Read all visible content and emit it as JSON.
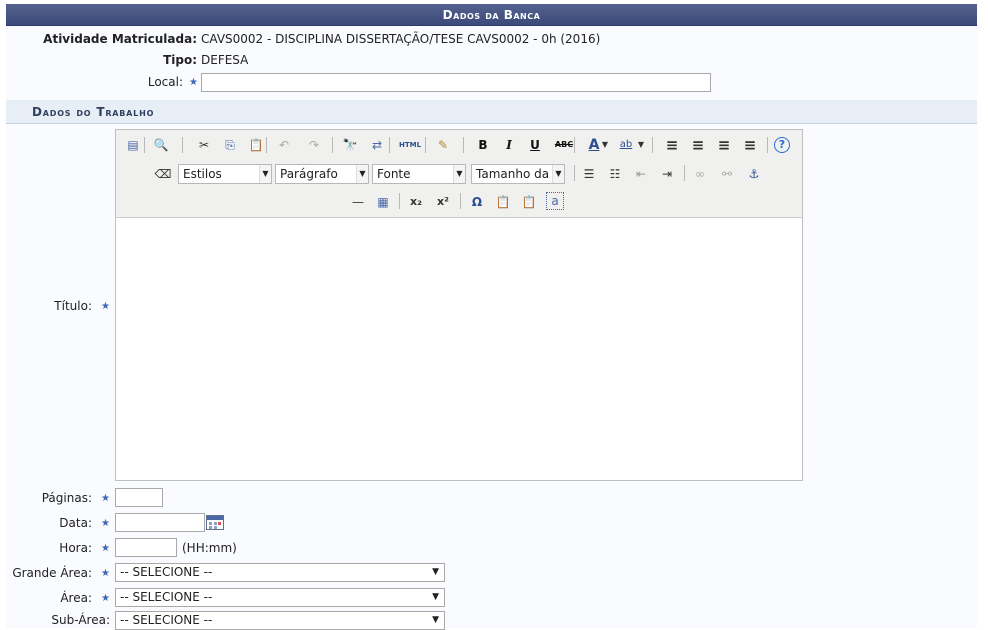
{
  "banner": {
    "title": "Dados da Banca"
  },
  "atividade": {
    "label": "Atividade Matriculada:",
    "value": "CAVS0002 - DISCIPLINA DISSERTAÇÃO/TESE CAVS0002 - 0h (2016)"
  },
  "tipo": {
    "label": "Tipo:",
    "value": "DEFESA"
  },
  "local": {
    "label": "Local:",
    "value": ""
  },
  "section": {
    "title": "Dados do Trabalho"
  },
  "titulo": {
    "label": "Título:"
  },
  "editor": {
    "row1": [
      {
        "name": "source-icon",
        "glyph": "▤"
      },
      {
        "name": "preview-icon",
        "glyph": "🔍"
      },
      {
        "name": "cut-icon",
        "glyph": "✂"
      },
      {
        "name": "copy-icon",
        "glyph": "⎘"
      },
      {
        "name": "paste-icon",
        "glyph": "📋"
      },
      {
        "name": "undo-icon",
        "glyph": "↶"
      },
      {
        "name": "redo-icon",
        "glyph": "↷"
      },
      {
        "name": "find-icon",
        "glyph": "🔭"
      },
      {
        "name": "replace-icon",
        "glyph": "⇄"
      },
      {
        "name": "html-icon",
        "glyph": "HTML"
      },
      {
        "name": "cleanup-icon",
        "glyph": "✎"
      },
      {
        "name": "bold-icon",
        "glyph": "B"
      },
      {
        "name": "italic-icon",
        "glyph": "I"
      },
      {
        "name": "underline-icon",
        "glyph": "U"
      },
      {
        "name": "strikethrough-icon",
        "glyph": "ABC"
      },
      {
        "name": "font-color-icon",
        "glyph": "A"
      },
      {
        "name": "highlight-icon",
        "glyph": "ab"
      },
      {
        "name": "align-left-icon",
        "glyph": "≡"
      },
      {
        "name": "align-center-icon",
        "glyph": "≡"
      },
      {
        "name": "align-right-icon",
        "glyph": "≡"
      },
      {
        "name": "align-justify-icon",
        "glyph": "≡"
      },
      {
        "name": "help-icon",
        "glyph": "?"
      }
    ],
    "styles_label": "Estilos",
    "paragraph_label": "Parágrafo",
    "font_label": "Fonte",
    "size_label": "Tamanho da F",
    "row2": [
      {
        "name": "eraser-icon",
        "glyph": "⌫"
      },
      {
        "name": "unordered-list-icon",
        "glyph": "☰"
      },
      {
        "name": "ordered-list-icon",
        "glyph": "☷"
      },
      {
        "name": "outdent-icon",
        "glyph": "⇤"
      },
      {
        "name": "indent-icon",
        "glyph": "⇥"
      },
      {
        "name": "link-icon",
        "glyph": "∞"
      },
      {
        "name": "unlink-icon",
        "glyph": "⚯"
      },
      {
        "name": "anchor-icon",
        "glyph": "⚓"
      }
    ],
    "row3": [
      {
        "name": "horizontal-rule-icon",
        "glyph": "—"
      },
      {
        "name": "table-icon",
        "glyph": "▦"
      },
      {
        "name": "subscript-icon",
        "glyph": "x₂"
      },
      {
        "name": "superscript-icon",
        "glyph": "x²"
      },
      {
        "name": "special-char-icon",
        "glyph": "Ω"
      },
      {
        "name": "paste-text-icon",
        "glyph": "📋"
      },
      {
        "name": "paste-word-icon",
        "glyph": "📋"
      },
      {
        "name": "select-all-icon",
        "glyph": "a"
      }
    ]
  },
  "paginas": {
    "label": "Páginas:",
    "value": ""
  },
  "data_field": {
    "label": "Data:",
    "value": ""
  },
  "hora": {
    "label": "Hora:",
    "value": "",
    "hint": "(HH:mm)"
  },
  "grande_area": {
    "label": "Grande Área:",
    "selected": "-- SELECIONE --"
  },
  "area": {
    "label": "Área:",
    "selected": "-- SELECIONE --"
  },
  "sub_area": {
    "label": "Sub-Área:",
    "selected": "-- SELECIONE --"
  }
}
